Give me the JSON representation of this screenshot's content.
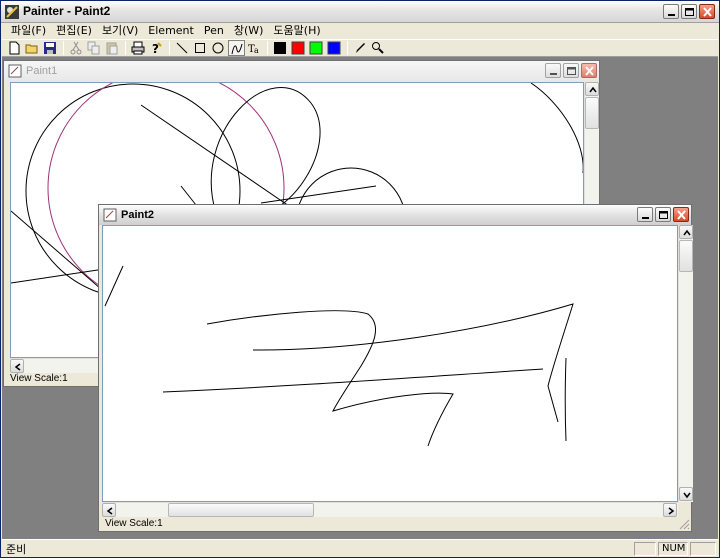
{
  "app": {
    "title": "Painter - Paint2"
  },
  "menu": [
    "파일(F)",
    "편집(E)",
    "보기(V)",
    "Element",
    "Pen",
    "창(W)",
    "도움말(H)"
  ],
  "toolbar": {
    "icons": [
      "new-file-icon",
      "open-folder-icon",
      "save-icon",
      "cut-icon",
      "copy-icon",
      "paste-icon",
      "print-icon",
      "help-icon",
      "line-tool-icon",
      "rectangle-tool-icon",
      "circle-tool-icon",
      "curve-tool-icon",
      "text-tool-icon",
      "color-black-icon",
      "color-red-icon",
      "color-green-icon",
      "color-blue-icon",
      "pen-icon",
      "zoom-icon"
    ],
    "colors": {
      "black": "#000000",
      "red": "#ff0000",
      "green": "#00ff00",
      "blue": "#0000ff"
    }
  },
  "windows": {
    "paint1": {
      "title": "Paint1",
      "status": "View Scale:1"
    },
    "paint2": {
      "title": "Paint2",
      "status": "View Scale:1"
    }
  },
  "statusbar": {
    "text": "준비",
    "num": "NUM"
  },
  "accent": {
    "circle": "#a0307a",
    "titlebar_inactive": "#a0a0a0"
  }
}
